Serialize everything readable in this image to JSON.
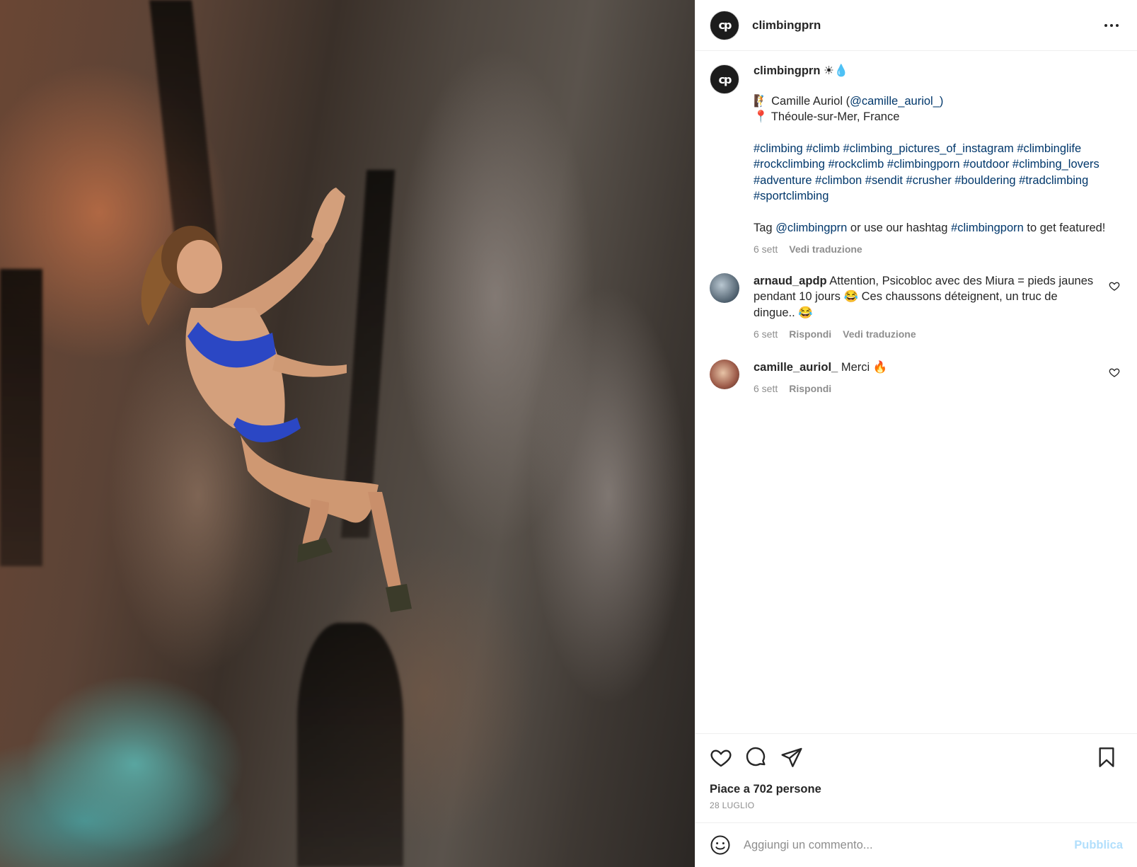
{
  "post": {
    "author": "climbingprn",
    "avatar_text": "cp",
    "more_icon": "more-options-icon",
    "photo_alt": "rock-climber-photo"
  },
  "caption": {
    "author": "climbingprn",
    "author_suffix": "☀💧",
    "line1_emoji": "🧗",
    "line1_name": "Camille Auriol (",
    "line1_handle": "@camille_auriol_",
    "line1_close": ")",
    "line2_emoji": "📍",
    "line2_text": "Théoule-sur-Mer, France",
    "hashtags": "#climbing #climb #climbing_pictures_of_instagram #climbinglife #rockclimbing #rockclimb #climbingporn #outdoor #climbing_lovers #adventure #climbon #sendit #crusher #bouldering #tradclimbing #sportclimbing",
    "tag_pre": "Tag ",
    "tag_handle": "@climbingprn",
    "tag_mid": " or use our hashtag ",
    "tag_hashtag": "#climbingporn",
    "tag_post": " to get featured!",
    "time": "6 sett",
    "translate": "Vedi traduzione"
  },
  "comments": [
    {
      "user": "arnaud_apdp",
      "text": "Attention, Psicobloc avec des Miura = pieds jaunes pendant 10 jours 😂 Ces chaussons déteignent, un truc de dingue.. 😂",
      "time": "6 sett",
      "reply": "Rispondi",
      "translate": "Vedi traduzione"
    },
    {
      "user": "camille_auriol_",
      "text": "Merci 🔥",
      "time": "6 sett",
      "reply": "Rispondi"
    }
  ],
  "likes_text": "Piace a 702 persone",
  "date_text": "28 LUGLIO",
  "comment_input": {
    "placeholder": "Aggiungi un commento...",
    "publish": "Pubblica"
  },
  "colors": {
    "link": "#00376b",
    "muted": "#8e8e8e",
    "publish_disabled": "#b2dffc"
  }
}
